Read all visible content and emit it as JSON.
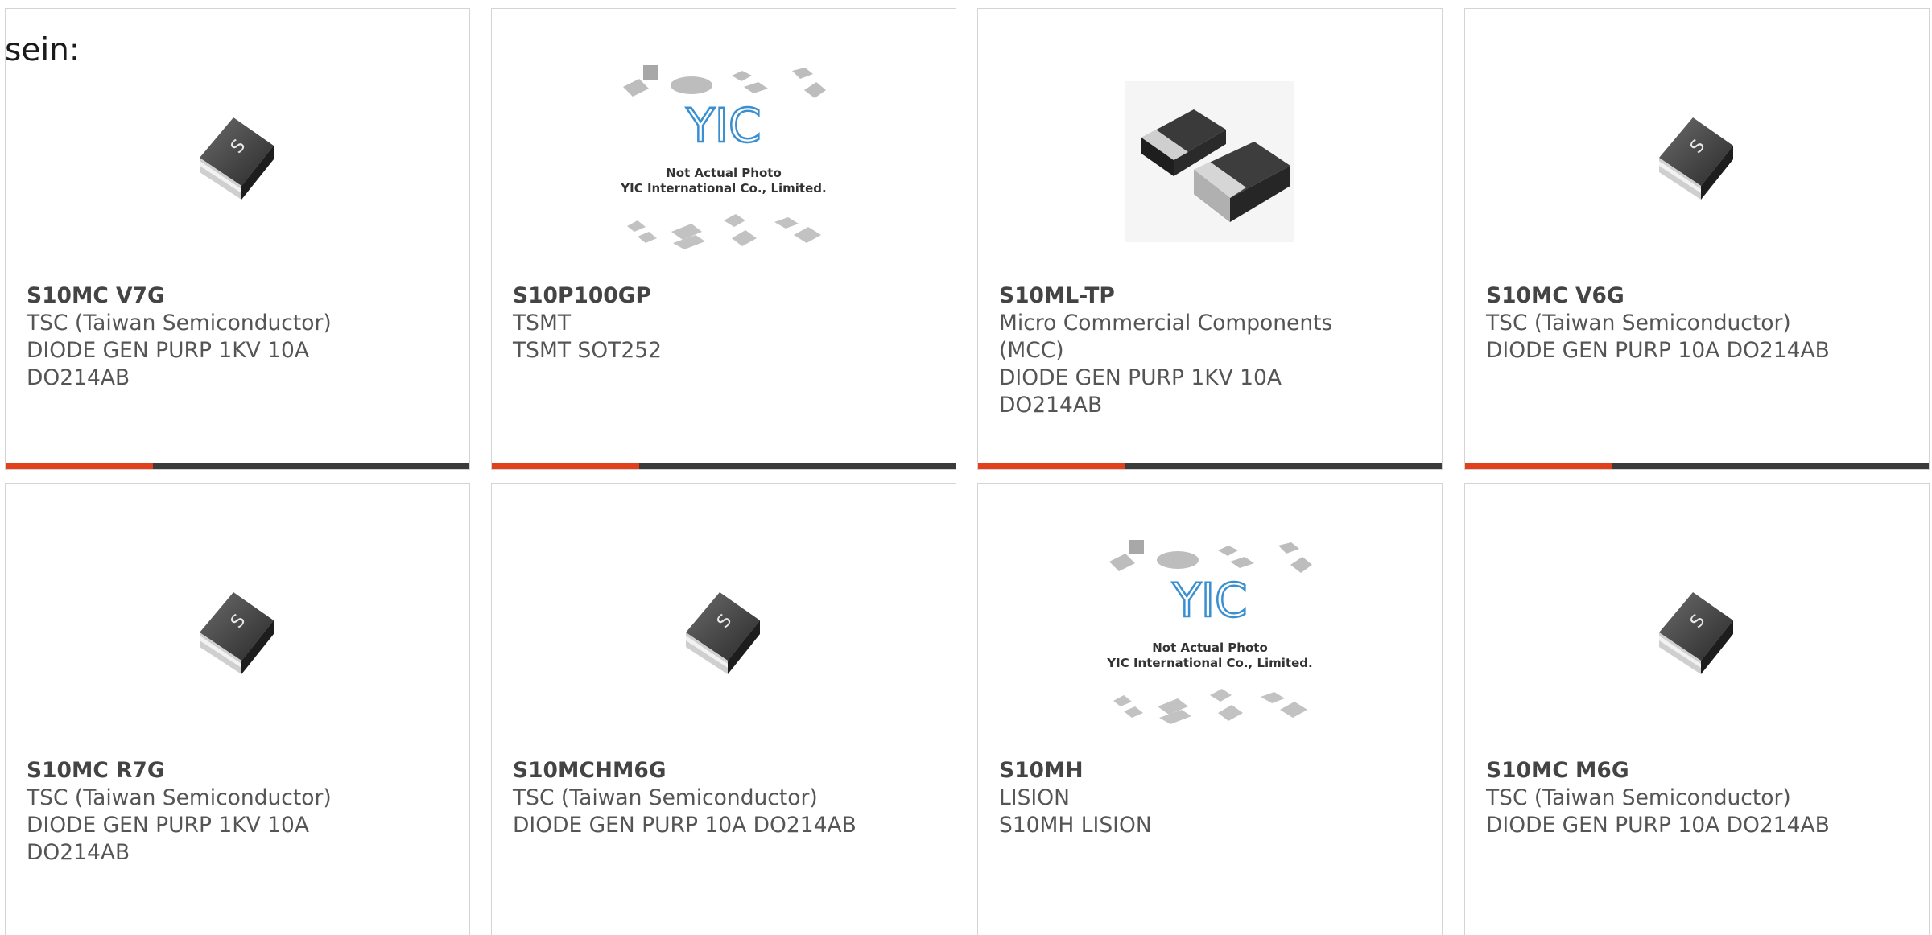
{
  "intro_text": "sein:",
  "colors": {
    "accent": "#e2401c",
    "bar": "#3b3b3b",
    "border": "#d4d4d4",
    "text": "#555555"
  },
  "placeholder_image": {
    "line1": "Not Actual Photo",
    "line2": "YIC International Co., Limited.",
    "logo": "YIC"
  },
  "products": [
    {
      "part": "S10MC V7G",
      "manufacturer": "TSC (Taiwan Semiconductor)",
      "description": "DIODE GEN PURP 1KV 10A DO214AB",
      "image": "tsc-chip-icon"
    },
    {
      "part": "S10P100GP",
      "manufacturer": "TSMT",
      "description": "TSMT SOT252",
      "image": "yic-placeholder-image"
    },
    {
      "part": "S10ML-TP",
      "manufacturer": "Micro Commercial Components (MCC)",
      "description": "DIODE GEN PURP 1KV 10A DO214AB",
      "image": "mcc-diode-photo"
    },
    {
      "part": "S10MC V6G",
      "manufacturer": "TSC (Taiwan Semiconductor)",
      "description": "DIODE GEN PURP 10A DO214AB",
      "image": "tsc-chip-icon"
    },
    {
      "part": "S10MC R7G",
      "manufacturer": "TSC (Taiwan Semiconductor)",
      "description": "DIODE GEN PURP 1KV 10A DO214AB",
      "image": "tsc-chip-icon"
    },
    {
      "part": "S10MCHM6G",
      "manufacturer": "TSC (Taiwan Semiconductor)",
      "description": "DIODE GEN PURP 10A DO214AB",
      "image": "tsc-chip-icon"
    },
    {
      "part": "S10MH",
      "manufacturer": "LISION",
      "description": "S10MH LISION",
      "image": "yic-placeholder-image"
    },
    {
      "part": "S10MC M6G",
      "manufacturer": "TSC (Taiwan Semiconductor)",
      "description": "DIODE GEN PURP 10A DO214AB",
      "image": "tsc-chip-icon"
    }
  ]
}
